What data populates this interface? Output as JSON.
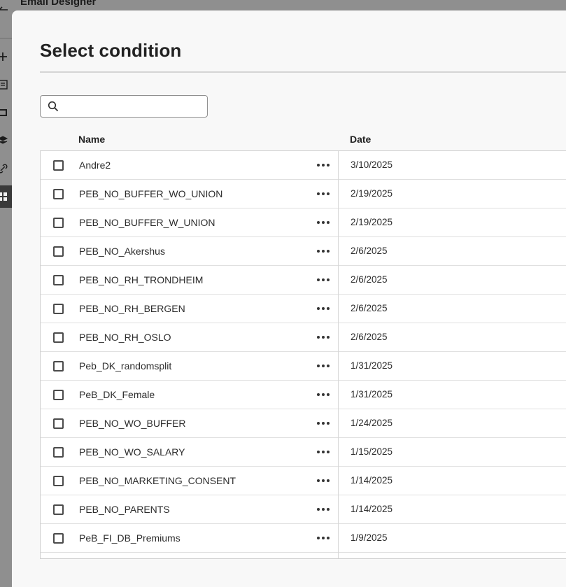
{
  "app": {
    "title": "Email Designer"
  },
  "rail": {
    "icons": [
      "back-arrow-icon",
      "add-icon",
      "form-icon",
      "gallery-icon",
      "layers-icon",
      "link-icon",
      "grid-icon"
    ]
  },
  "dialog": {
    "title": "Select condition",
    "search": {
      "placeholder": "",
      "value": ""
    }
  },
  "table": {
    "columns": {
      "name": "Name",
      "date": "Date"
    },
    "rows": [
      {
        "name": "Andre2",
        "date": "3/10/2025"
      },
      {
        "name": "PEB_NO_BUFFER_WO_UNION",
        "date": "2/19/2025"
      },
      {
        "name": "PEB_NO_BUFFER_W_UNION",
        "date": "2/19/2025"
      },
      {
        "name": "PEB_NO_Akershus",
        "date": "2/6/2025"
      },
      {
        "name": "PEB_NO_RH_TRONDHEIM",
        "date": "2/6/2025"
      },
      {
        "name": "PEB_NO_RH_BERGEN",
        "date": "2/6/2025"
      },
      {
        "name": "PEB_NO_RH_OSLO",
        "date": "2/6/2025"
      },
      {
        "name": "Peb_DK_randomsplit",
        "date": "1/31/2025"
      },
      {
        "name": "PeB_DK_Female",
        "date": "1/31/2025"
      },
      {
        "name": "PEB_NO_WO_BUFFER",
        "date": "1/24/2025"
      },
      {
        "name": "PEB_NO_WO_SALARY",
        "date": "1/15/2025"
      },
      {
        "name": "PEB_NO_MARKETING_CONSENT",
        "date": "1/14/2025"
      },
      {
        "name": "PEB_NO_PARENTS",
        "date": "1/14/2025"
      },
      {
        "name": "PeB_FI_DB_Premiums",
        "date": "1/9/2025"
      },
      {
        "name": "",
        "date": ""
      }
    ]
  }
}
